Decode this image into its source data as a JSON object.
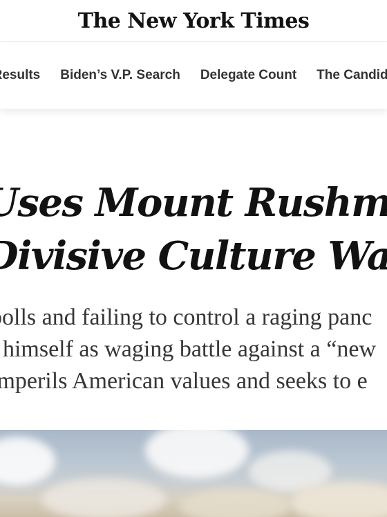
{
  "masthead": {
    "logo_text": "The New York Times"
  },
  "nav": {
    "items": [
      {
        "label": "t Results"
      },
      {
        "label": "Biden’s V.P. Search"
      },
      {
        "label": "Delegate Count"
      },
      {
        "label": "The Candid"
      }
    ]
  },
  "article": {
    "headline_lines": [
      "Uses Mount Rushmore S",
      "Divisive Culture War M"
    ],
    "summary_lines": [
      "polls and failing to control a raging panc",
      "t himself as waging battle against a “new",
      "imperils American values and seeks to e"
    ]
  }
}
